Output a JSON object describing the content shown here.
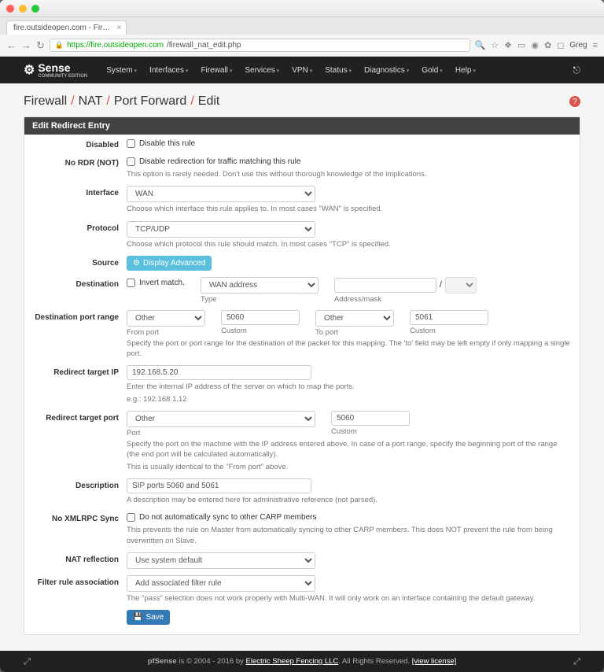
{
  "browser": {
    "tab_title": "fire.outsideopen.com - Fir…",
    "url_host": "https://fire.outsideopen.com",
    "url_path": "/firewall_nat_edit.php",
    "user": "Greg"
  },
  "nav": {
    "logo": "Sense",
    "logo_sub": "COMMUNITY EDITION",
    "items": [
      "System",
      "Interfaces",
      "Firewall",
      "Services",
      "VPN",
      "Status",
      "Diagnostics",
      "Gold",
      "Help"
    ]
  },
  "breadcrumb": [
    "Firewall",
    "NAT",
    "Port Forward",
    "Edit"
  ],
  "panel_title": "Edit Redirect Entry",
  "labels": {
    "disabled": "Disabled",
    "nordr": "No RDR (NOT)",
    "interface": "Interface",
    "protocol": "Protocol",
    "source": "Source",
    "destination": "Destination",
    "dst_port_range": "Destination port range",
    "redirect_ip": "Redirect target IP",
    "redirect_port": "Redirect target port",
    "description": "Description",
    "no_sync": "No XMLRPC Sync",
    "nat_reflection": "NAT reflection",
    "filter_assoc": "Filter rule association"
  },
  "fields": {
    "disabled_check": "Disable this rule",
    "nordr_check": "Disable redirection for traffic matching this rule",
    "nordr_help": "This option is rarely needed. Don't use this without thorough knowledge of the implications.",
    "interface_value": "WAN",
    "interface_help": "Choose which interface this rule applies to. In most cases \"WAN\" is specified.",
    "protocol_value": "TCP/UDP",
    "protocol_help": "Choose which protocol this rule should match. In most cases \"TCP\" is specified.",
    "source_btn": "Display Advanced",
    "dest_invert": "Invert match.",
    "dest_type": "WAN address",
    "dest_type_label": "Type",
    "dest_mask_label": "Address/mask",
    "dest_slash": "/",
    "dpr_from": "Other",
    "dpr_from_custom": "5060",
    "dpr_to": "Other",
    "dpr_to_custom": "5061",
    "dpr_from_label": "From port",
    "dpr_custom_label": "Custom",
    "dpr_to_label": "To port",
    "dpr_help": "Specify the port or port range for the destination of the packet for this mapping. The 'to' field may be left empty if only mapping a single port.",
    "redirect_ip_value": "192.168.5.20",
    "redirect_ip_help": "Enter the internal IP address of the server on which to map the ports.",
    "redirect_ip_eg": "e.g.: 192.168.1.12",
    "redirect_port_sel": "Other",
    "redirect_port_custom": "5060",
    "redirect_port_label": "Port",
    "redirect_port_help1": "Specify the port on the machine with the IP address entered above. In case of a port range, specify the beginning port of the range (the end port will be calculated automatically).",
    "redirect_port_help2": "This is usually identical to the \"From port\" above.",
    "description_value": "SIP ports 5060 and 5061",
    "description_help": "A description may be entered here for administrative reference (not parsed).",
    "nosync_check": "Do not automatically sync to other CARP members",
    "nosync_help": "This prevents the rule on Master from automatically syncing to other CARP members. This does NOT prevent the rule from being overwritten on Slave.",
    "nat_reflection_value": "Use system default",
    "filter_assoc_value": "Add associated filter rule",
    "filter_assoc_help": "The \"pass\" selection does not work properly with Multi-WAN. It will only work on an interface containing the default gateway."
  },
  "save_btn": "Save",
  "footer": {
    "prefix": "pfSense",
    "text1": " is © 2004 - 2016 by ",
    "link": "Electric Sheep Fencing LLC",
    "text2": ". All Rights Reserved. ",
    "license": "[view license]"
  }
}
